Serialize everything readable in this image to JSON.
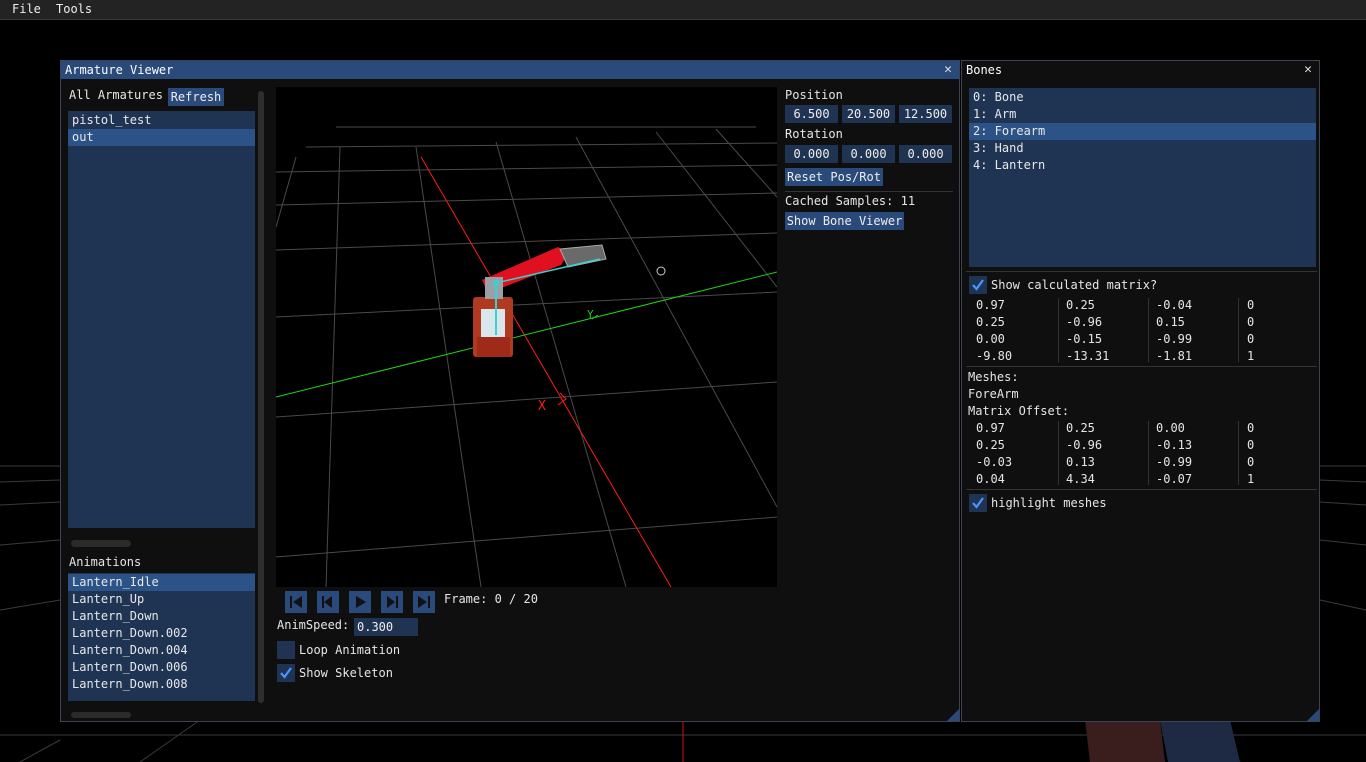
{
  "menu": {
    "items": [
      "File",
      "Tools"
    ]
  },
  "armature_window": {
    "title": "Armature Viewer",
    "all_armatures_label": "All Armatures",
    "refresh_label": "Refresh",
    "armatures": [
      "pistol_test",
      "out"
    ],
    "selected_armature": "out",
    "animations_label": "Animations",
    "animations": [
      "Lantern_Idle",
      "Lantern_Up",
      "Lantern_Down",
      "Lantern_Down.002",
      "Lantern_Down.004",
      "Lantern_Down.006",
      "Lantern_Down.008"
    ],
    "selected_animation": "Lantern_Idle",
    "position_label": "Position",
    "position": [
      "6.500",
      "20.500",
      "12.500"
    ],
    "rotation_label": "Rotation",
    "rotation": [
      "0.000",
      "0.000",
      "0.000"
    ],
    "reset_label": "Reset Pos/Rot",
    "cached_samples": "Cached Samples: 11",
    "show_bone_viewer_label": "Show Bone Viewer",
    "frame_text": "Frame: 0 / 20",
    "anim_speed_label": "AnimSpeed:",
    "anim_speed_value": "0.300",
    "loop_animation_label": "Loop Animation",
    "loop_animation_checked": false,
    "show_skeleton_label": "Show Skeleton",
    "show_skeleton_checked": true,
    "viewport_axis_label": "Y",
    "viewport_axis_label_x": "X"
  },
  "bones_window": {
    "title": "Bones",
    "bones": [
      "0: Bone",
      "1: Arm",
      "2: Forearm",
      "3: Hand",
      "4: Lantern"
    ],
    "selected_bone": "2: Forearm",
    "show_calc_label": "Show calculated matrix?",
    "show_calc_checked": true,
    "calculated_matrix": [
      [
        "0.97",
        "0.25",
        "-0.04",
        "0"
      ],
      [
        "0.25",
        "-0.96",
        "0.15",
        "0"
      ],
      [
        "0.00",
        "-0.15",
        "-0.99",
        "0"
      ],
      [
        "-9.80",
        "-13.31",
        "-1.81",
        "1"
      ]
    ],
    "meshes_label": "Meshes:",
    "mesh_name": "ForeArm",
    "matrix_offset_label": "Matrix Offset:",
    "offset_matrix": [
      [
        "0.97",
        "0.25",
        "0.00",
        "0"
      ],
      [
        "0.25",
        "-0.96",
        "-0.13",
        "0"
      ],
      [
        "-0.03",
        "0.13",
        "-0.99",
        "0"
      ],
      [
        "0.04",
        "4.34",
        "-0.07",
        "1"
      ]
    ],
    "highlight_label": "highlight meshes",
    "highlight_checked": true
  },
  "colors": {
    "accent": "#294a7a",
    "selected": "#2c5387",
    "list_bg": "#1f3353",
    "axis_red": "#ff1a1a",
    "axis_green": "#1fd11f"
  }
}
